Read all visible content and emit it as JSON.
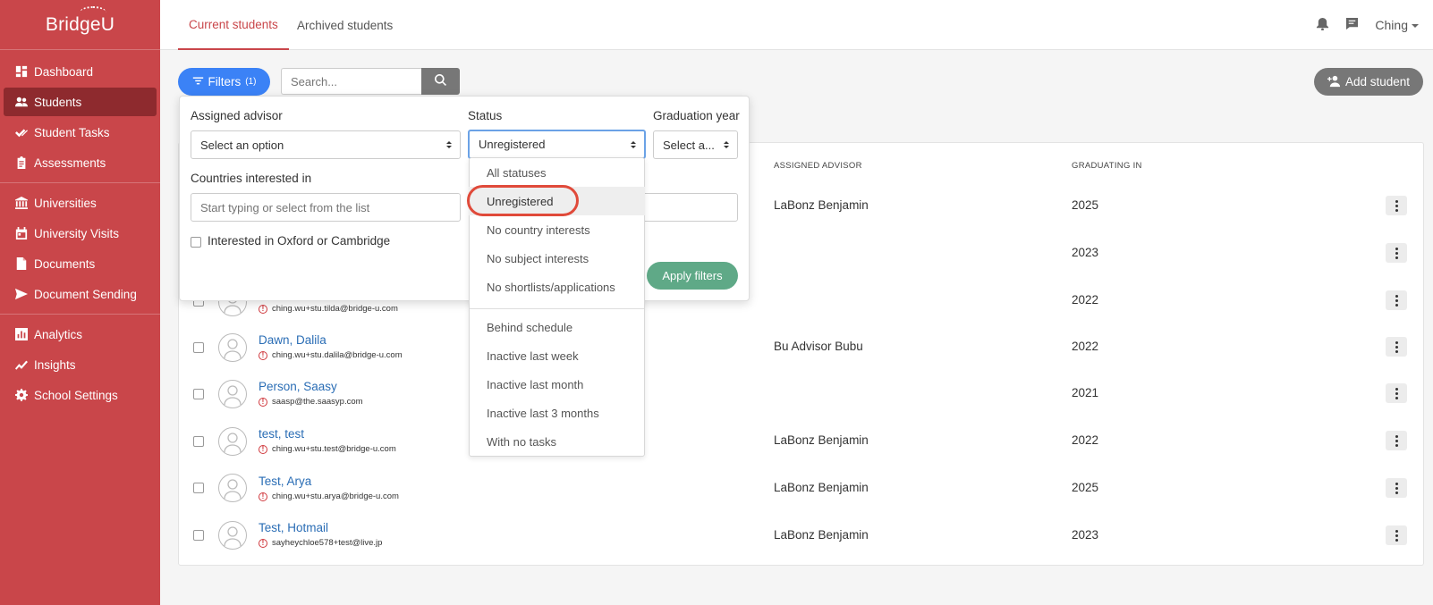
{
  "app": {
    "logo": "BridgeU"
  },
  "sidebar": {
    "group1": [
      {
        "label": "Dashboard",
        "icon": "dashboard-icon"
      },
      {
        "label": "Students",
        "icon": "users-icon",
        "active": true
      },
      {
        "label": "Student Tasks",
        "icon": "checks-icon"
      },
      {
        "label": "Assessments",
        "icon": "clipboard-icon"
      }
    ],
    "group2": [
      {
        "label": "Universities",
        "icon": "university-icon"
      },
      {
        "label": "University Visits",
        "icon": "calendar-icon"
      },
      {
        "label": "Documents",
        "icon": "document-icon"
      },
      {
        "label": "Document Sending",
        "icon": "send-icon"
      }
    ],
    "group3": [
      {
        "label": "Analytics",
        "icon": "bar-chart-icon"
      },
      {
        "label": "Insights",
        "icon": "trend-icon"
      },
      {
        "label": "School Settings",
        "icon": "gear-icon"
      }
    ]
  },
  "tabs": [
    "Current students",
    "Archived students"
  ],
  "header": {
    "user": "Ching"
  },
  "toolbar": {
    "filters_label": "Filters",
    "filters_count": "(1)",
    "search_placeholder": "Search...",
    "add_student": "Add student"
  },
  "table": {
    "headers": {
      "advisor": "ASSIGNED ADVISOR",
      "graduating": "GRADUATING IN"
    },
    "rows": [
      {
        "name": "",
        "email": "",
        "advisor": "LaBonz Benjamin",
        "grad": "2025"
      },
      {
        "name": "",
        "email": "",
        "advisor": "",
        "grad": "2023"
      },
      {
        "name": "",
        "email": "ching.wu+stu.tilda@bridge-u.com",
        "advisor": "",
        "grad": "2022"
      },
      {
        "name": "Dawn, Dalila",
        "email": "ching.wu+stu.dalila@bridge-u.com",
        "advisor": "Bu Advisor Bubu",
        "grad": "2022"
      },
      {
        "name": "Person, Saasy",
        "email": "saasp@the.saasyp.com",
        "advisor": "",
        "grad": "2021"
      },
      {
        "name": "test, test",
        "email": "ching.wu+stu.test@bridge-u.com",
        "advisor": "LaBonz Benjamin",
        "grad": "2022"
      },
      {
        "name": "Test, Arya",
        "email": "ching.wu+stu.arya@bridge-u.com",
        "advisor": "LaBonz Benjamin",
        "grad": "2025"
      },
      {
        "name": "Test, Hotmail",
        "email": "sayheychloe578+test@live.jp",
        "advisor": "LaBonz Benjamin",
        "grad": "2023"
      }
    ]
  },
  "filters": {
    "advisor_label": "Assigned advisor",
    "advisor_value": "Select an option",
    "status_label": "Status",
    "status_value": "Unregistered",
    "grad_label": "Graduation year",
    "grad_value": "Select a...",
    "countries_label": "Countries interested in",
    "countries_placeholder": "Start typing or select from the list",
    "oxbridge_label": "Interested in Oxford or Cambridge",
    "apply_label": "Apply filters"
  },
  "status_options": {
    "group1": [
      "All statuses",
      "Unregistered",
      "No country interests",
      "No subject interests",
      "No shortlists/applications"
    ],
    "group2": [
      "Behind schedule",
      "Inactive last week",
      "Inactive last month",
      "Inactive last 3 months",
      "With no tasks"
    ],
    "highlighted": "Unregistered"
  },
  "colors": {
    "sidebar": "#c9464a",
    "active_nav": "#8e2a2e",
    "primary": "#3b82f6",
    "apply": "#5fa987",
    "link": "#2a6db5",
    "highlight_ring": "#e04a3a"
  }
}
